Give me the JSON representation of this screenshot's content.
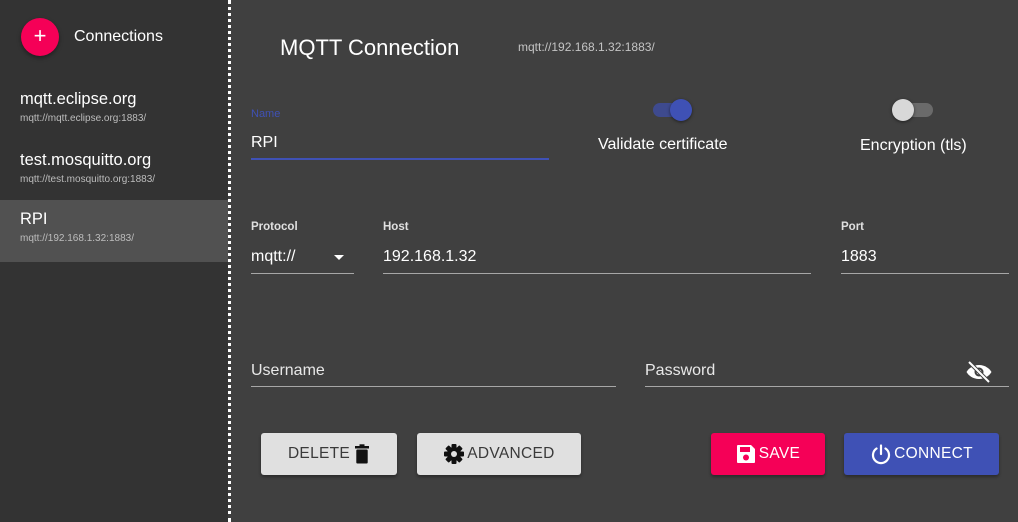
{
  "sidebar": {
    "add_label": "+",
    "title": "Connections",
    "items": [
      {
        "name": "mqtt.eclipse.org",
        "url": "mqtt://mqtt.eclipse.org:1883/"
      },
      {
        "name": "test.mosquitto.org",
        "url": "mqtt://test.mosquitto.org:1883/"
      },
      {
        "name": "RPI",
        "url": "mqtt://192.168.1.32:1883/"
      }
    ]
  },
  "header": {
    "title": "MQTT Connection",
    "subtitle": "mqtt://192.168.1.32:1883/"
  },
  "form": {
    "name_label": "Name",
    "name_value": "RPI",
    "validate_certificate_label": "Validate certificate",
    "validate_certificate_on": true,
    "encryption_label": "Encryption (tls)",
    "encryption_on": false,
    "protocol_label": "Protocol",
    "protocol_value": "mqtt://",
    "host_label": "Host",
    "host_value": "192.168.1.32",
    "port_label": "Port",
    "port_value": "1883",
    "username_placeholder": "Username",
    "password_placeholder": "Password"
  },
  "buttons": {
    "delete": "DELETE",
    "advanced": "ADVANCED",
    "save": "SAVE",
    "connect": "CONNECT"
  },
  "colors": {
    "accent_pink": "#f50057",
    "primary_blue": "#3f51b5",
    "sidebar_bg": "#333333",
    "main_bg": "#404040"
  },
  "icons": {
    "add": "plus-icon",
    "visibility": "eye-off-icon",
    "delete": "trash-icon",
    "advanced": "gear-icon",
    "save": "floppy-icon",
    "connect": "power-icon"
  }
}
